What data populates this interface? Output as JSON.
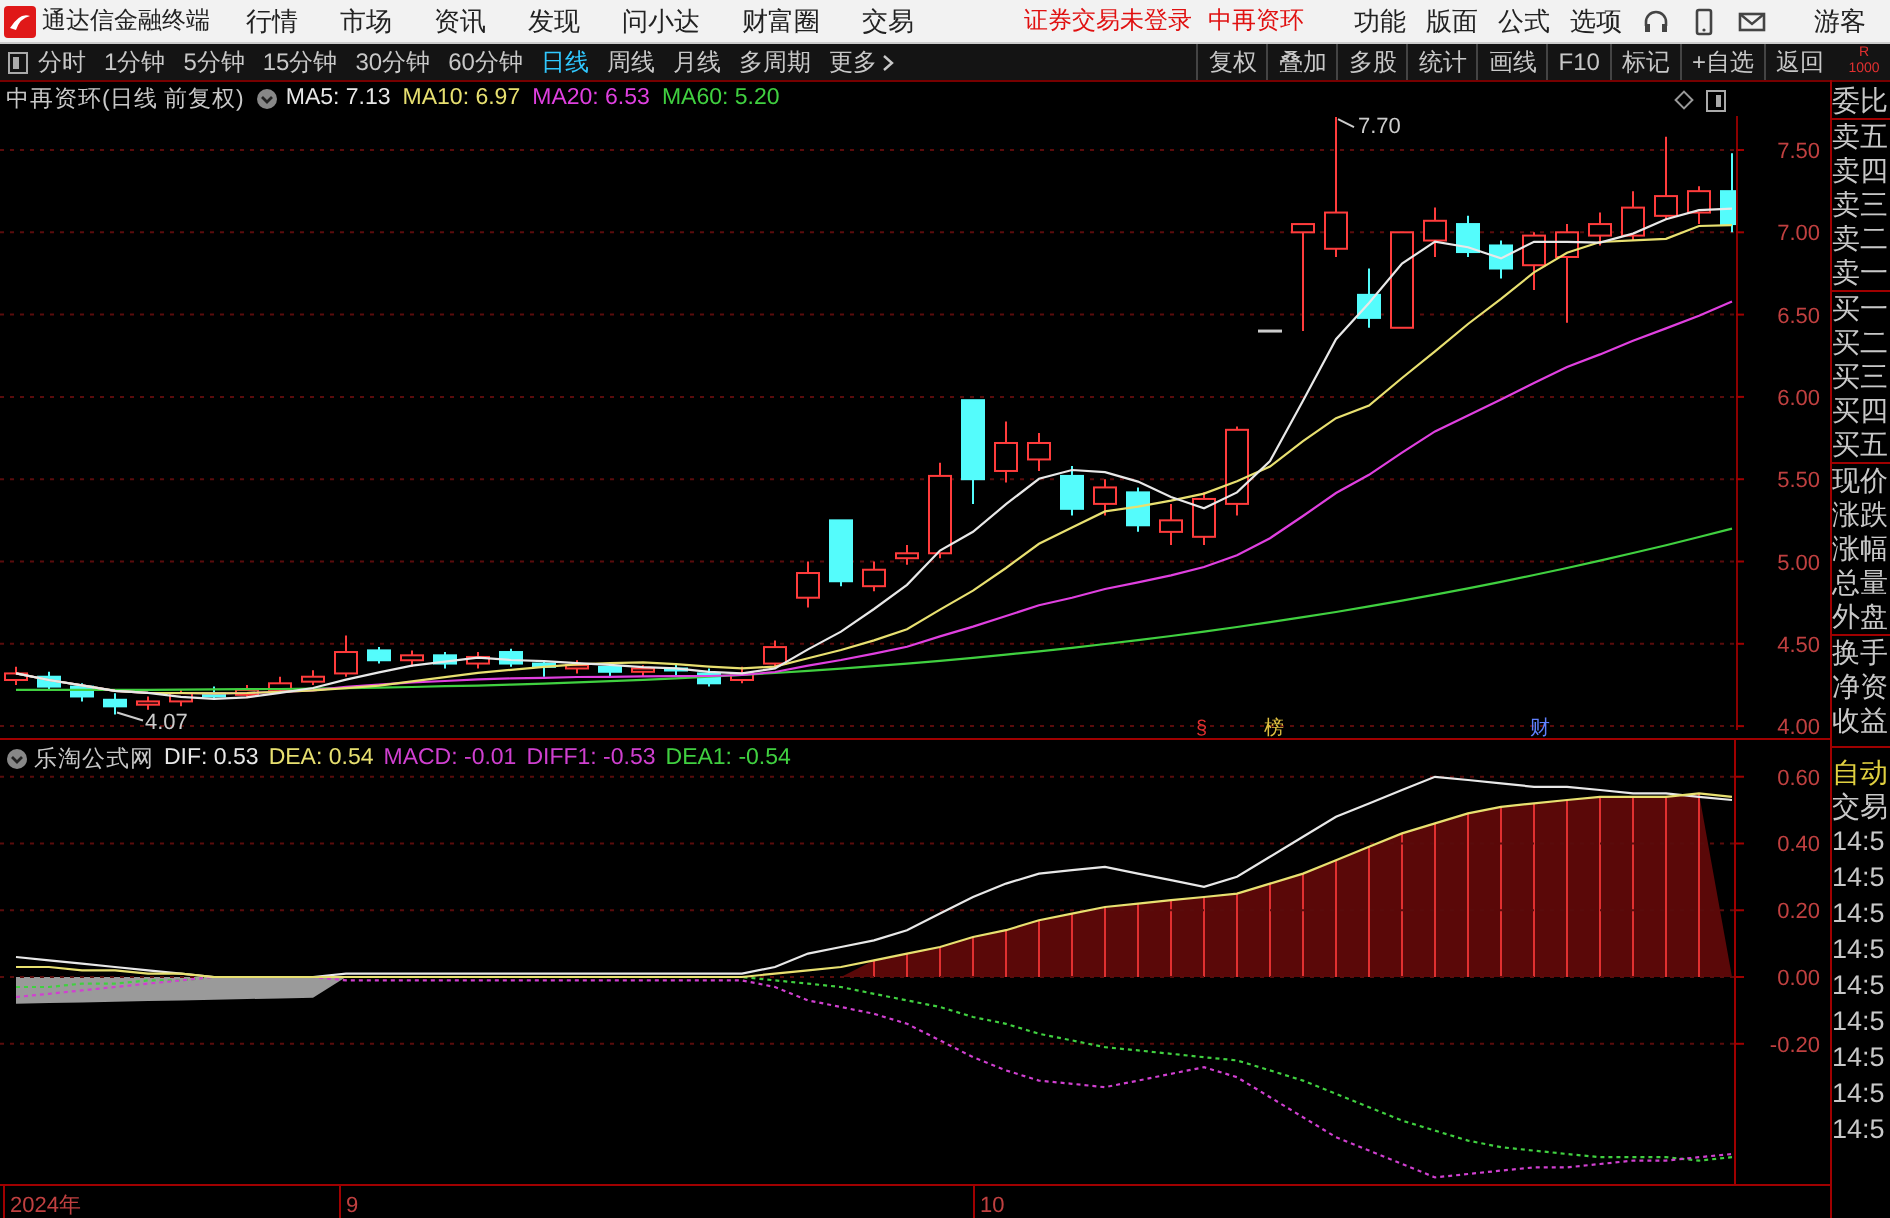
{
  "title_bar": {
    "app_name": "通达信金融终端",
    "menu": [
      "行情",
      "市场",
      "资讯",
      "发现",
      "问小达",
      "财富圈",
      "交易"
    ],
    "notices": [
      "证券交易未登录",
      "中再资环"
    ],
    "right_menu": [
      "功能",
      "版面",
      "公式",
      "选项"
    ],
    "user": "游客"
  },
  "period_tabs": [
    {
      "label": "分时",
      "selected": false
    },
    {
      "label": "1分钟",
      "selected": false
    },
    {
      "label": "5分钟",
      "selected": false
    },
    {
      "label": "15分钟",
      "selected": false
    },
    {
      "label": "30分钟",
      "selected": false
    },
    {
      "label": "60分钟",
      "selected": false
    },
    {
      "label": "日线",
      "selected": true
    },
    {
      "label": "周线",
      "selected": false
    },
    {
      "label": "月线",
      "selected": false
    },
    {
      "label": "多周期",
      "selected": false
    },
    {
      "label": "更多",
      "selected": false
    }
  ],
  "tools": [
    "复权",
    "叠加",
    "多股",
    "统计",
    "画线",
    "F10",
    "标记",
    "+自选",
    "返回"
  ],
  "corner_badge": [
    "R",
    "1000"
  ],
  "price_chart": {
    "title": "中再资环(日线 前复权)",
    "indicators": [
      {
        "label": "MA5: 7.13",
        "color": "#e8e8e8"
      },
      {
        "label": "MA10: 6.97",
        "color": "#e8e070"
      },
      {
        "label": "MA20: 6.53",
        "color": "#e040e0"
      },
      {
        "label": "MA60: 5.20",
        "color": "#40d040"
      }
    ],
    "yticks": [
      "7.50",
      "7.00",
      "6.50",
      "6.00",
      "5.50",
      "5.00",
      "4.50",
      "4.00"
    ],
    "high_label": "7.70",
    "low_label": "4.07",
    "event_marks": [
      {
        "text": "§",
        "color": "#e03030"
      },
      {
        "text": "榜",
        "color": "#e0c040"
      },
      {
        "text": "财",
        "color": "#6080ff"
      }
    ]
  },
  "macd_chart": {
    "title": "乐淘公式网",
    "legend": [
      {
        "kind": "series"
      },
      {
        "kind": "series"
      },
      {
        "kind": "text",
        "label": "MACD: -0.01",
        "color": "#d040d0"
      },
      {
        "kind": "series"
      },
      {
        "kind": "series"
      }
    ],
    "chart_data": {
      "type": "line",
      "grid": true,
      "yticks": [
        {
          "value": 0.6,
          "label": "0.60"
        },
        {
          "value": 0.4,
          "label": "0.40"
        },
        {
          "value": 0.2,
          "label": "0.20"
        },
        {
          "value": 0,
          "label": "0.00"
        },
        {
          "value": -0.2,
          "label": "-0.20"
        }
      ],
      "ylim": [
        -0.62,
        0.71
      ],
      "series": [
        {
          "name": "DIF: 0.53",
          "color": "#e8e8e8",
          "values": [
            0.06,
            0.05,
            0.04,
            0.03,
            0.02,
            0.01,
            0,
            0,
            0,
            0,
            0.01,
            0.01,
            0.01,
            0.01,
            0.01,
            0.01,
            0.01,
            0.01,
            0.01,
            0.01,
            0.01,
            0.01,
            0.01,
            0.03,
            0.07,
            0.09,
            0.11,
            0.14,
            0.19,
            0.24,
            0.28,
            0.31,
            0.32,
            0.33,
            0.31,
            0.29,
            0.27,
            0.3,
            0.36,
            0.42,
            0.48,
            0.52,
            0.56,
            0.6,
            0.59,
            0.58,
            0.57,
            0.57,
            0.56,
            0.55,
            0.55,
            0.54,
            0.53
          ]
        },
        {
          "name": "DEA: 0.54",
          "color": "#e8e070",
          "values": [
            0.03,
            0.03,
            0.02,
            0.02,
            0.01,
            0.01,
            0,
            0,
            0,
            0,
            0,
            0,
            0,
            0,
            0,
            0,
            0,
            0,
            0,
            0,
            0,
            0,
            0,
            0.01,
            0.02,
            0.03,
            0.05,
            0.07,
            0.09,
            0.12,
            0.14,
            0.17,
            0.19,
            0.21,
            0.22,
            0.23,
            0.24,
            0.25,
            0.28,
            0.31,
            0.35,
            0.39,
            0.43,
            0.46,
            0.49,
            0.51,
            0.52,
            0.53,
            0.54,
            0.54,
            0.54,
            0.55,
            0.54
          ]
        },
        {
          "name": "DIFF1: -0.53",
          "color": "#d040d0",
          "line_style": "dashed",
          "values": [
            -0.06,
            -0.05,
            -0.04,
            -0.03,
            -0.02,
            -0.01,
            0,
            0,
            0,
            0,
            -0.01,
            -0.01,
            -0.01,
            -0.01,
            -0.01,
            -0.01,
            -0.01,
            -0.01,
            -0.01,
            -0.01,
            -0.01,
            -0.01,
            -0.01,
            -0.03,
            -0.07,
            -0.09,
            -0.11,
            -0.14,
            -0.19,
            -0.24,
            -0.28,
            -0.31,
            -0.32,
            -0.33,
            -0.31,
            -0.29,
            -0.27,
            -0.3,
            -0.36,
            -0.42,
            -0.48,
            -0.52,
            -0.56,
            -0.6,
            -0.59,
            -0.58,
            -0.57,
            -0.57,
            -0.56,
            -0.55,
            -0.55,
            -0.54,
            -0.53
          ]
        },
        {
          "name": "DEA1: -0.54",
          "color": "#40d040",
          "line_style": "dashed",
          "values": [
            -0.03,
            -0.03,
            -0.02,
            -0.02,
            -0.01,
            -0.01,
            0,
            0,
            0,
            0,
            0,
            0,
            0,
            0,
            0,
            0,
            0,
            0,
            0,
            0,
            0,
            0,
            0,
            -0.01,
            -0.02,
            -0.03,
            -0.05,
            -0.07,
            -0.09,
            -0.12,
            -0.14,
            -0.17,
            -0.19,
            -0.21,
            -0.22,
            -0.23,
            -0.24,
            -0.25,
            -0.28,
            -0.31,
            -0.35,
            -0.39,
            -0.43,
            -0.46,
            -0.49,
            -0.51,
            -0.52,
            -0.53,
            -0.54,
            -0.54,
            -0.54,
            -0.55,
            -0.54
          ]
        }
      ]
    }
  },
  "date_axis": [
    "2024年",
    "9",
    "10"
  ],
  "quote_panel": [
    {
      "kind": "label",
      "items": [
        "委比"
      ]
    },
    {
      "kind": "label",
      "items": [
        "卖五",
        "卖四",
        "卖三",
        "卖二",
        "卖一"
      ]
    },
    {
      "kind": "label",
      "items": [
        "买一",
        "买二",
        "买三",
        "买四",
        "买五"
      ]
    },
    {
      "kind": "label",
      "items": [
        "现价",
        "涨跌",
        "涨幅",
        "总量",
        "外盘"
      ]
    },
    {
      "kind": "label",
      "items": [
        "换手",
        "净资",
        "收益"
      ]
    },
    {
      "kind": "mode",
      "on": true,
      "items": [
        "自动"
      ]
    },
    {
      "kind": "label",
      "items": [
        "交易"
      ]
    },
    {
      "kind": "time",
      "items": [
        "14:5",
        "14:5",
        "14:5",
        "14:5",
        "14:5",
        "14:5",
        "14:5",
        "14:5",
        "14:5"
      ]
    }
  ]
}
